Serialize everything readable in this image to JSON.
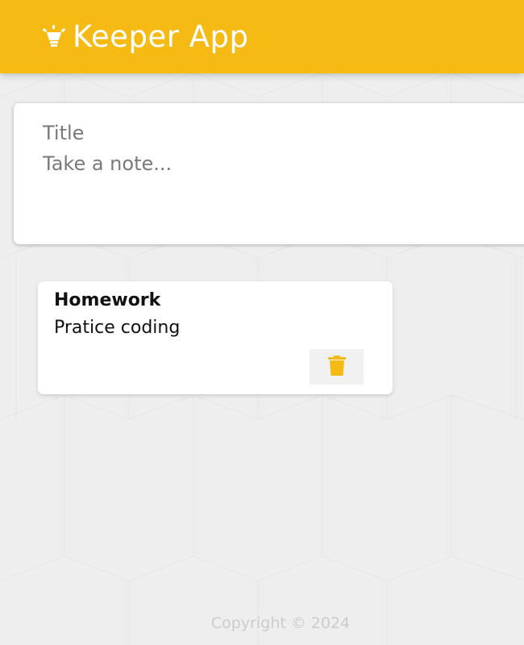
{
  "app": {
    "title": "Keeper App",
    "brand_icon": "lightbulb-icon",
    "accent_color": "#f5ba13",
    "background_color": "#eeeeee"
  },
  "create_note": {
    "title_placeholder": "Title",
    "content_placeholder": "Take a note..."
  },
  "notes": [
    {
      "title": "Homework",
      "content": "Pratice coding",
      "delete_icon": "trash-icon"
    }
  ],
  "footer": {
    "copyright": "Copyright © 2024"
  }
}
